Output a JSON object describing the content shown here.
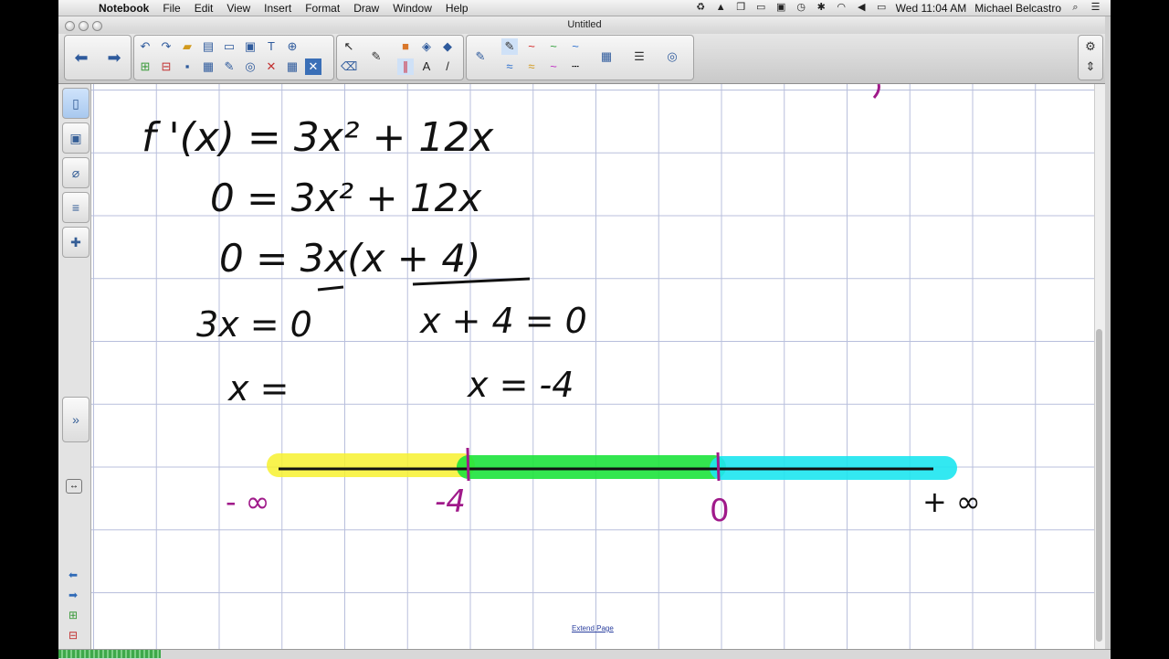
{
  "menubar": {
    "app": "Notebook",
    "menus": [
      "File",
      "Edit",
      "View",
      "Insert",
      "Format",
      "Draw",
      "Window",
      "Help"
    ],
    "clock": "Wed 11:04 AM",
    "user": "Michael Belcastro"
  },
  "window": {
    "title": "Untitled"
  },
  "toolbar": {
    "icons": [
      "back-icon",
      "forward-icon",
      "undo-icon",
      "redo-icon",
      "open-icon",
      "save-icon",
      "screen-shade-icon",
      "capture-icon",
      "pen-icon",
      "eraser-icon",
      "highlighter-icon",
      "color-palette-icon",
      "properties-icon",
      "settings-icon"
    ],
    "pen_colors": [
      "#d42222",
      "#2f9e3a",
      "#2b6fcf",
      "#c02dc3",
      "#000000"
    ]
  },
  "whiteboard": {
    "derivative": "f '(x) = 3x² + 12x",
    "step1": "0 = 3x² + 12x",
    "step2": "0 = 3x(x + 4)",
    "factor1": "3x = 0",
    "factor2": "x + 4 = 0",
    "sol1": "x =",
    "sol2": "x = -4",
    "label_neg_inf": "- ∞",
    "label_neg4": "-4",
    "label_zero": "0",
    "label_pos_inf": "+ ∞",
    "interval_colors": [
      "#f7f230",
      "#1ee43c",
      "#1ee6f0"
    ]
  },
  "footer": {
    "extend_page": "Extend Page"
  }
}
